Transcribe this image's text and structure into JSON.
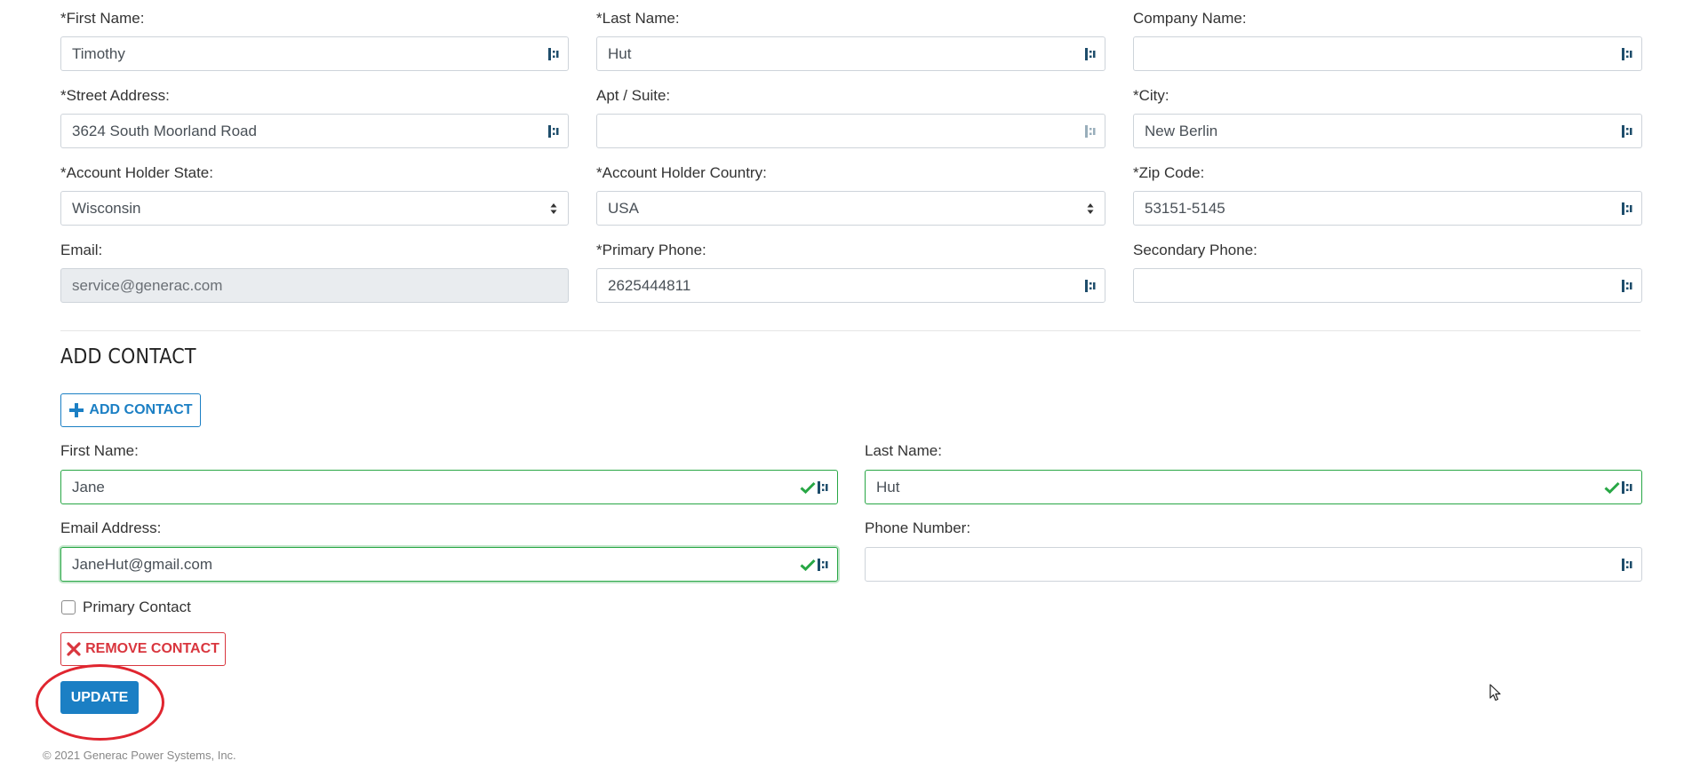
{
  "account": {
    "first_name": {
      "label": "*First Name:",
      "value": "Timothy"
    },
    "last_name": {
      "label": "*Last Name:",
      "value": "Hut"
    },
    "company_name": {
      "label": "Company Name:",
      "value": ""
    },
    "street_address": {
      "label": "*Street Address:",
      "value": "3624 South Moorland Road"
    },
    "apt_suite": {
      "label": "Apt / Suite:",
      "value": ""
    },
    "city": {
      "label": "*City:",
      "value": "New Berlin"
    },
    "state": {
      "label": "*Account Holder State:",
      "value": "Wisconsin"
    },
    "country": {
      "label": "*Account Holder Country:",
      "value": "USA"
    },
    "zip": {
      "label": "*Zip Code:",
      "value": "53151-5145"
    },
    "email": {
      "label": "Email:",
      "value": "service@generac.com"
    },
    "primary_phone": {
      "label": "*Primary Phone:",
      "value": "2625444811"
    },
    "secondary_phone": {
      "label": "Secondary Phone:",
      "value": ""
    }
  },
  "add_contact": {
    "title": "ADD CONTACT",
    "add_button_label": "ADD CONTACT",
    "contact": {
      "first_name": {
        "label": "First Name:",
        "value": "Jane"
      },
      "last_name": {
        "label": "Last Name:",
        "value": "Hut"
      },
      "email": {
        "label": "Email Address:",
        "value": "JaneHut@gmail.com"
      },
      "phone": {
        "label": "Phone Number:",
        "value": ""
      },
      "primary_contact_label": "Primary Contact",
      "primary_contact_checked": false,
      "remove_button_label": "REMOVE CONTACT"
    }
  },
  "update_button_label": "UPDATE",
  "footer": {
    "copyright": "© 2021 Generac Power Systems, Inc."
  },
  "colors": {
    "primary": "#1b7fc4",
    "danger": "#d9363e",
    "valid": "#28a745",
    "annotation": "#e0252f"
  },
  "icons": [
    "lastpass-icon",
    "check-icon",
    "select-arrows-icon",
    "plus-icon",
    "x-icon",
    "cursor-icon"
  ]
}
